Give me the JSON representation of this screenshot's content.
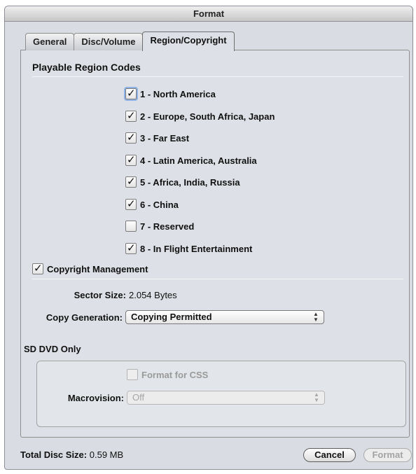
{
  "window": {
    "title": "Format"
  },
  "tabs": [
    {
      "label": "General",
      "active": false
    },
    {
      "label": "Disc/Volume",
      "active": false
    },
    {
      "label": "Region/Copyright",
      "active": true
    }
  ],
  "region": {
    "section_title": "Playable Region Codes",
    "codes": [
      {
        "label": "1 - North America",
        "checked": true
      },
      {
        "label": "2 - Europe, South Africa, Japan",
        "checked": true
      },
      {
        "label": "3 - Far East",
        "checked": true
      },
      {
        "label": "4 - Latin America, Australia",
        "checked": true
      },
      {
        "label": "5 - Africa, India, Russia",
        "checked": true
      },
      {
        "label": "6 - China",
        "checked": true
      },
      {
        "label": "7 - Reserved",
        "checked": false
      },
      {
        "label": "8 - In Flight Entertainment",
        "checked": true
      }
    ]
  },
  "copyright": {
    "label": "Copyright Management",
    "checked": true,
    "sector_size_label": "Sector Size:",
    "sector_size_value": "2.054 Bytes",
    "copy_generation_label": "Copy Generation:",
    "copy_generation_value": "Copying Permitted"
  },
  "sd_dvd": {
    "section_title": "SD DVD Only",
    "format_css_label": "Format for CSS",
    "format_css_checked": false,
    "macrovision_label": "Macrovision:",
    "macrovision_value": "Off"
  },
  "footer": {
    "total_label": "Total Disc Size:",
    "total_value": "0.59 MB",
    "cancel_label": "Cancel",
    "format_label": "Format"
  },
  "icons": {
    "checkmark": "checkmark-icon",
    "popup_arrows": "updown-arrows-icon"
  }
}
